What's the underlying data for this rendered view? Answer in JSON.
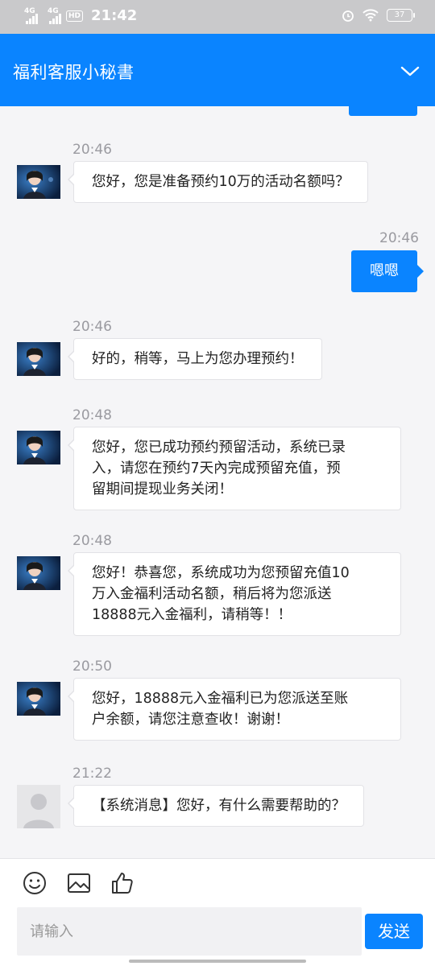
{
  "status_bar": {
    "network_1": "4G",
    "network_2": "4G",
    "hd_badge": "HD",
    "time": "21:42",
    "battery": "37"
  },
  "header": {
    "title": "福利客服小秘書"
  },
  "messages": [
    {
      "time": "20:46",
      "side": "left",
      "text": "您好，您是准备预约10万的活动名额吗？"
    },
    {
      "time": "20:46",
      "side": "right",
      "text": "嗯嗯"
    },
    {
      "time": "20:46",
      "side": "left",
      "text": "好的，稍等，马上为您办理预约！"
    },
    {
      "time": "20:48",
      "side": "left",
      "lines": [
        "您好，您已成功预约预留活动，系统已录",
        "入，请您在预约7天內完成预留充值，预",
        "留期间提现业务关闭！"
      ]
    },
    {
      "time": "20:48",
      "side": "left",
      "lines": [
        "您好！恭喜您，系统成功为您预留充值10",
        "万入金福利活动名额，稍后将为您派送",
        "18888元入金福利，请稍等！！"
      ]
    },
    {
      "time": "20:50",
      "side": "left",
      "lines": [
        "您好，18888元入金福利已为您派送至账",
        "户余额，请您注意查收！谢谢！"
      ]
    },
    {
      "time": "21:22",
      "side": "left",
      "text": "【系统消息】您好，有什么需要帮助的？"
    }
  ],
  "composer": {
    "placeholder": "请输入",
    "send_label": "发送"
  },
  "icons": [
    "emoji-icon",
    "image-icon",
    "thumbs-up-icon",
    "chevron-down-icon"
  ]
}
